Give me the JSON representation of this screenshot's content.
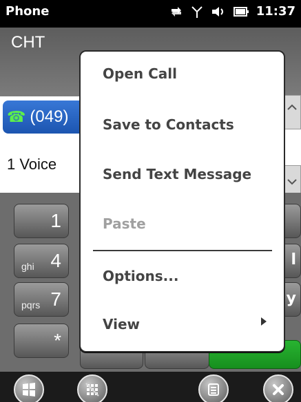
{
  "status_bar": {
    "title": "Phone",
    "time": "11:37"
  },
  "carrier": {
    "name": "CHT"
  },
  "call_log": {
    "number_partial": "(049)",
    "voicemail": "1  Voice"
  },
  "keypad": {
    "keys": [
      {
        "digit": "1",
        "letters": ""
      },
      {
        "digit": "4",
        "letters": "ghi"
      },
      {
        "digit": "7",
        "letters": "pqrs"
      },
      {
        "digit": "*",
        "letters": ""
      }
    ],
    "right_keys": [
      "",
      "l",
      "y"
    ]
  },
  "context_menu": {
    "items": [
      {
        "label": "Open Call",
        "enabled": true
      },
      {
        "label": "Save to Contacts",
        "enabled": true
      },
      {
        "label": "Send Text Message",
        "enabled": true
      },
      {
        "label": "Paste",
        "enabled": false
      },
      {
        "label": "Options...",
        "enabled": true
      },
      {
        "label": "View",
        "enabled": true,
        "submenu": true
      }
    ]
  },
  "bottom_bar": {
    "buttons": [
      "start-icon",
      "keypad-icon",
      "menu-icon",
      "close-icon"
    ]
  },
  "colors": {
    "accent_blue": "#1c55b0",
    "call_green": "#178f1e",
    "status_black": "#000000",
    "menu_text": "#444444",
    "menu_disabled": "#a0a0a0"
  }
}
